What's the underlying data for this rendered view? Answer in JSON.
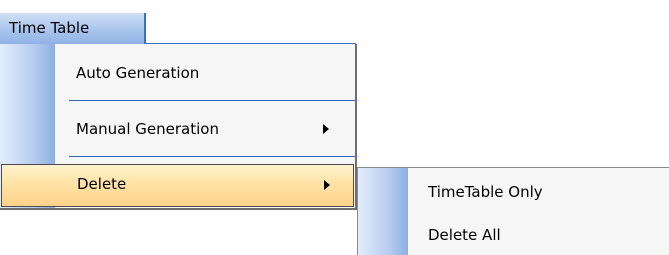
{
  "menubar": {
    "title": "Time Table"
  },
  "menu": {
    "items": [
      {
        "label": "Auto Generation",
        "has_submenu": false
      },
      {
        "label": "Manual Generation",
        "has_submenu": true
      },
      {
        "label": "Delete",
        "has_submenu": true,
        "highlighted": true
      }
    ]
  },
  "submenu": {
    "items": [
      {
        "label": "TimeTable Only"
      },
      {
        "label": "Delete All"
      }
    ]
  },
  "colors": {
    "highlight": "#ffd28a",
    "menu_border_accent": "#3e6fc6",
    "menu_background": "#f6f6f6"
  }
}
